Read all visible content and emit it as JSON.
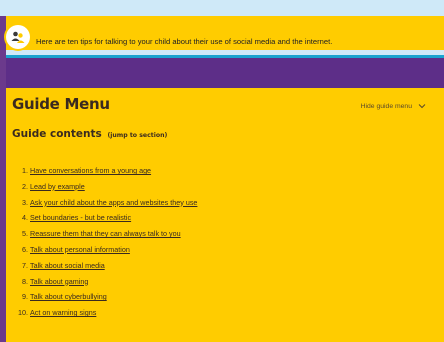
{
  "banner": {
    "text": "Here are ten tips for talking to your child about their use of social media and the internet."
  },
  "guide": {
    "title": "Guide Menu",
    "hide_label": "Hide guide menu",
    "contents_heading": "Guide contents",
    "jump_label": "(jump to section)",
    "items": [
      {
        "num": "1.",
        "label": "Have conversations from a young age"
      },
      {
        "num": "2.",
        "label": "Lead by example"
      },
      {
        "num": "3.",
        "label": "Ask your child about the apps and websites they use"
      },
      {
        "num": "4.",
        "label": "Set boundaries - but be realistic"
      },
      {
        "num": "5.",
        "label": "Reassure them that they can always talk to you"
      },
      {
        "num": "6.",
        "label": "Talk about personal information"
      },
      {
        "num": "7.",
        "label": "Talk about social media"
      },
      {
        "num": "8.",
        "label": "Talk about gaming"
      },
      {
        "num": "9.",
        "label": "Talk about cyberbullying"
      },
      {
        "num": "10.",
        "label": "Act on warning signs"
      }
    ]
  },
  "colors": {
    "accent_yellow": "#ffcc00",
    "purple": "#5d2e88",
    "teal": "#1aa2cf"
  },
  "icons": {
    "avatar": "people-icon",
    "hide_menu": "chevron-down-icon"
  }
}
